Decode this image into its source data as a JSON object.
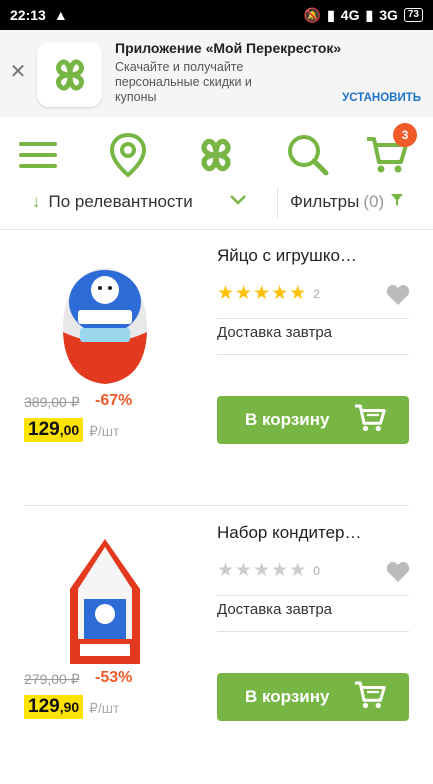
{
  "status": {
    "time": "22:13",
    "net1": "4G",
    "net2": "3G",
    "battery": "73"
  },
  "banner": {
    "title": "Приложение «Мой Перекресток»",
    "desc": "Скачайте и получайте персональные скидки и купоны",
    "install": "УСТАНОВИТЬ"
  },
  "header": {
    "cart_count": "3"
  },
  "sort": {
    "label": "По релевантности",
    "filters": "Фильтры",
    "filters_count": "(0)"
  },
  "colors": {
    "brand_green": "#77b644",
    "discount": "#f15a29",
    "price_highlight": "#ffe300",
    "star": "#ffc107"
  },
  "products": [
    {
      "name": "Яйцо с игрушко…",
      "rating": 5,
      "reviews": "2",
      "delivery": "Доставка завтра",
      "old_price": "389,00 ₽",
      "discount": "-67%",
      "price_int": "129",
      "price_dec": ",00",
      "unit": "₽/шт",
      "cart": "В корзину"
    },
    {
      "name": "Набор кондитер…",
      "rating": 0,
      "reviews": "0",
      "delivery": "Доставка завтра",
      "old_price": "279,00 ₽",
      "discount": "-53%",
      "price_int": "129",
      "price_dec": ",90",
      "unit": "₽/шт",
      "cart": "В корзину"
    }
  ]
}
